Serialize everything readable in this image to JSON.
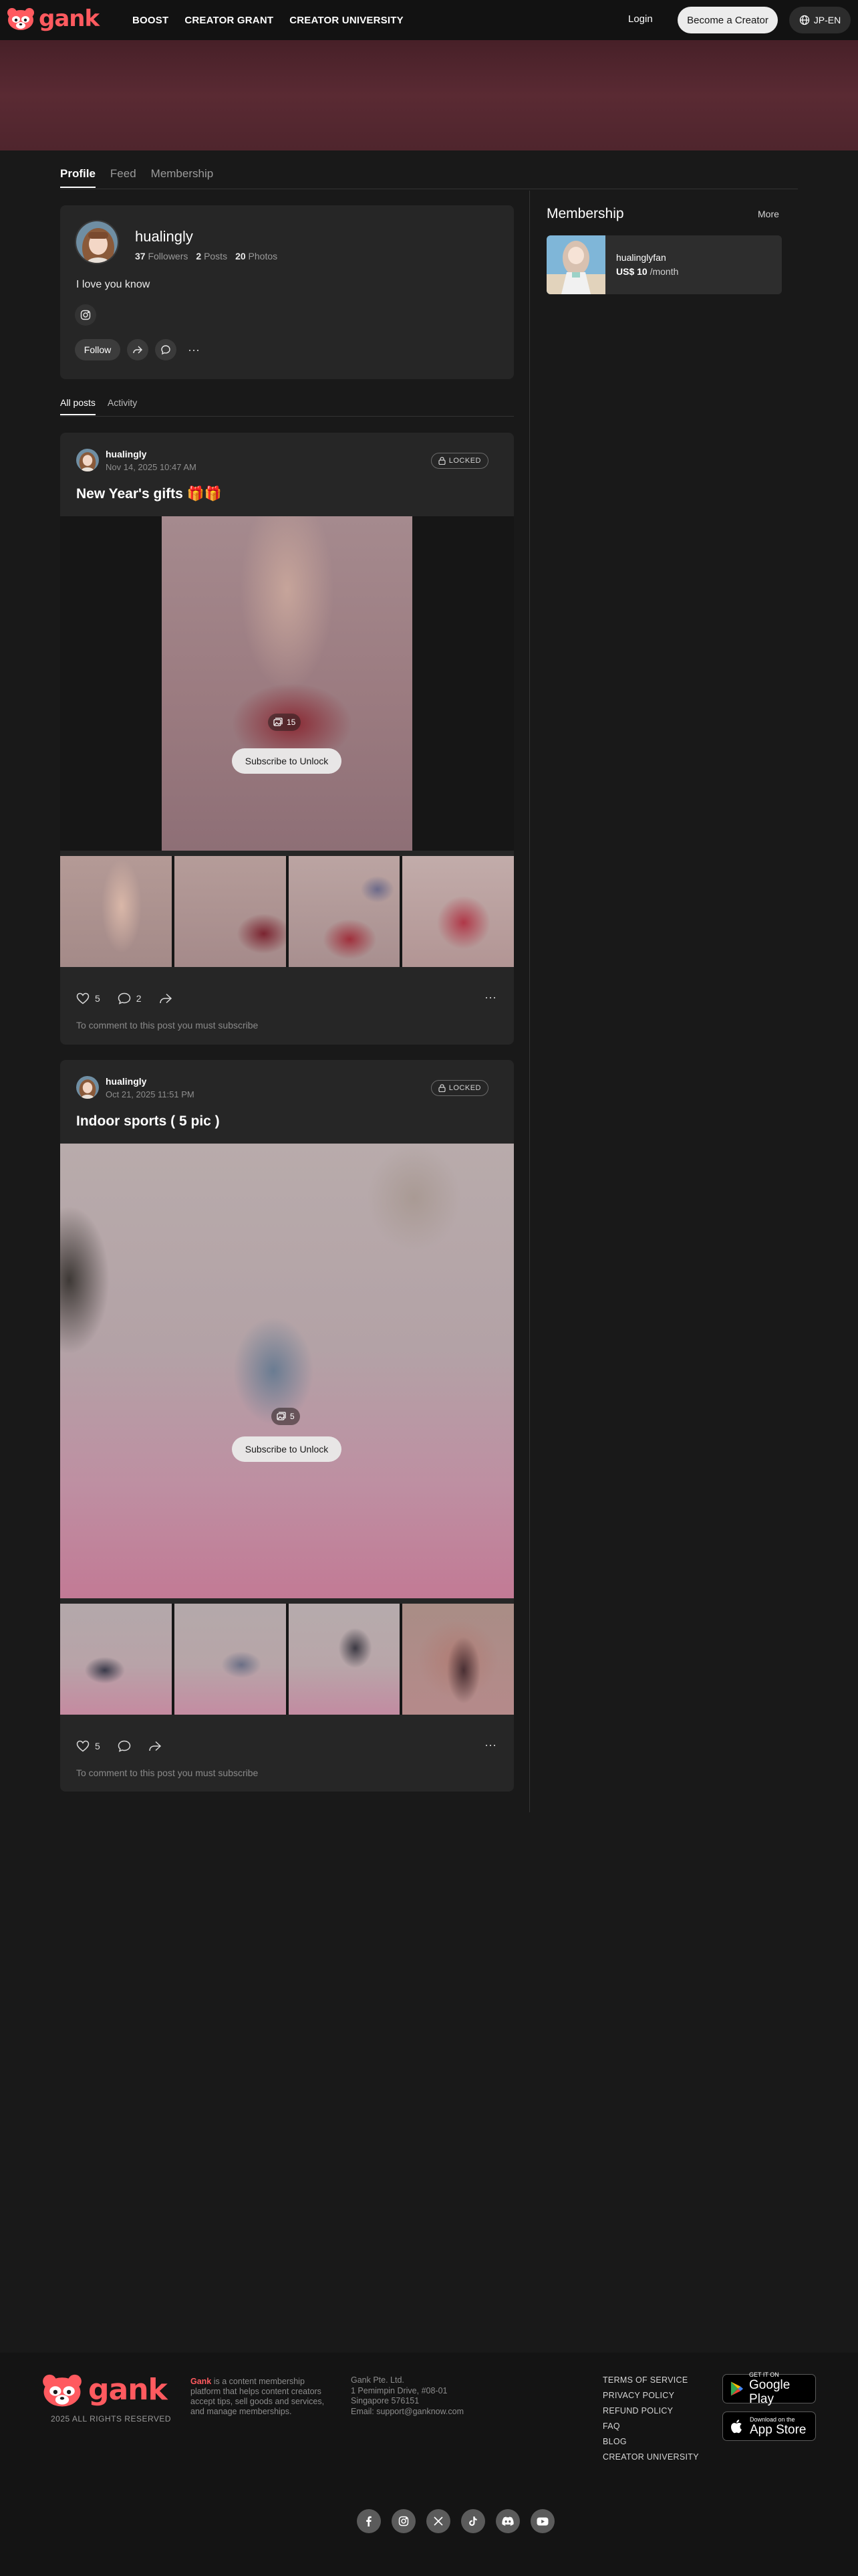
{
  "header": {
    "brand": "gank",
    "nav": [
      "BOOST",
      "CREATOR GRANT",
      "CREATOR UNIVERSITY"
    ],
    "login": "Login",
    "become": "Become a Creator",
    "lang": "JP-EN"
  },
  "tabs": [
    "Profile",
    "Feed",
    "Membership"
  ],
  "profile": {
    "name": "hualingly",
    "followers_count": "37",
    "followers_label": "Followers",
    "posts_count": "2",
    "posts_label": "Posts",
    "photos_count": "20",
    "photos_label": "Photos",
    "bio": "I love you know",
    "follow": "Follow",
    "more": "···"
  },
  "subtabs": [
    "All posts",
    "Activity"
  ],
  "posts": [
    {
      "author": "hualingly",
      "date": "Nov 14, 2025 10:47 AM",
      "locked": "LOCKED",
      "title": "New Year's gifts 🎁🎁",
      "image_count": "15",
      "unlock": "Subscribe to Unlock",
      "likes": "5",
      "comments": "2",
      "more": "···",
      "comment_note": "To comment to this post you must subscribe"
    },
    {
      "author": "hualingly",
      "date": "Oct 21, 2025 11:51 PM",
      "locked": "LOCKED",
      "title": "Indoor sports ( 5 pic )",
      "image_count": "5",
      "unlock": "Subscribe to Unlock",
      "likes": "5",
      "more": "···",
      "comment_note": "To comment to this post you must subscribe"
    }
  ],
  "sidebar": {
    "title": "Membership",
    "more": "More",
    "tier": {
      "name": "hualinglyfan",
      "price": "US$ 10",
      "period": "/month"
    }
  },
  "footer": {
    "brand": "gank",
    "rights": "2025 ALL RIGHTS RESERVED",
    "desc_brand": "Gank",
    "desc": " is a content membership platform that helps content creators accept tips, sell goods and services, and manage memberships.",
    "company": [
      "Gank Pte. Ltd.",
      "1 Pemimpin Drive, #08-01",
      "Singapore 576151",
      "Email: support@ganknow.com"
    ],
    "links": [
      "TERMS OF SERVICE",
      "PRIVACY POLICY",
      "REFUND POLICY",
      "FAQ",
      "BLOG",
      "CREATOR UNIVERSITY"
    ],
    "google_small": "GET IT ON",
    "google_big": "Google Play",
    "apple_small": "Download on the",
    "apple_big": "App Store"
  },
  "colors": {
    "brand": "#ff5a5f",
    "background": "#191919",
    "card": "#262626"
  }
}
